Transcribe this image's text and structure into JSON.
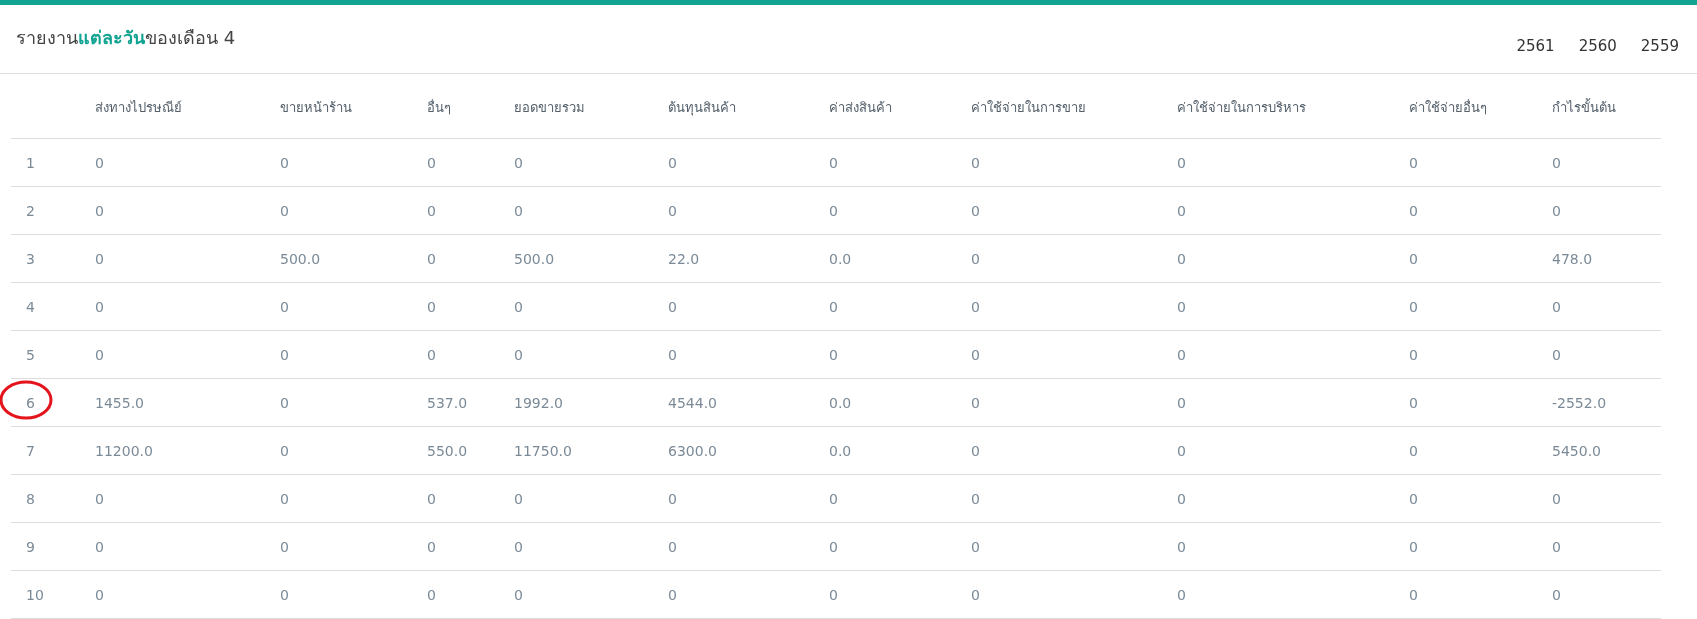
{
  "header": {
    "title": "รายงาน**แต่ละวัน**ของเดือน 4",
    "years": [
      "2561",
      "2560",
      "2559"
    ]
  },
  "table": {
    "columns": [
      "",
      "ส่งทางไปรษณีย์",
      "ขายหน้าร้าน",
      "อื่นๆ",
      "ยอดขายรวม",
      "ต้นทุนสินค้า",
      "ค่าส่งสินค้า",
      "ค่าใช้จ่ายในการขาย",
      "ค่าใช้จ่ายในการบริหาร",
      "ค่าใช้จ่ายอื่นๆ",
      "กำไรขั้นต้น"
    ],
    "rows": [
      {
        "circled": false,
        "cells": [
          "1",
          "0",
          "0",
          "0",
          "0",
          "0",
          "0",
          "0",
          "0",
          "0",
          "0"
        ]
      },
      {
        "circled": false,
        "cells": [
          "2",
          "0",
          "0",
          "0",
          "0",
          "0",
          "0",
          "0",
          "0",
          "0",
          "0"
        ]
      },
      {
        "circled": false,
        "cells": [
          "3",
          "0",
          "500.0",
          "0",
          "500.0",
          "22.0",
          "0.0",
          "0",
          "0",
          "0",
          "478.0"
        ]
      },
      {
        "circled": false,
        "cells": [
          "4",
          "0",
          "0",
          "0",
          "0",
          "0",
          "0",
          "0",
          "0",
          "0",
          "0"
        ]
      },
      {
        "circled": false,
        "cells": [
          "5",
          "0",
          "0",
          "0",
          "0",
          "0",
          "0",
          "0",
          "0",
          "0",
          "0"
        ]
      },
      {
        "circled": true,
        "cells": [
          "6",
          "1455.0",
          "0",
          "537.0",
          "1992.0",
          "4544.0",
          "0.0",
          "0",
          "0",
          "0",
          "-2552.0"
        ]
      },
      {
        "circled": false,
        "cells": [
          "7",
          "11200.0",
          "0",
          "550.0",
          "11750.0",
          "6300.0",
          "0.0",
          "0",
          "0",
          "0",
          "5450.0"
        ]
      },
      {
        "circled": false,
        "cells": [
          "8",
          "0",
          "0",
          "0",
          "0",
          "0",
          "0",
          "0",
          "0",
          "0",
          "0"
        ]
      },
      {
        "circled": false,
        "cells": [
          "9",
          "0",
          "0",
          "0",
          "0",
          "0",
          "0",
          "0",
          "0",
          "0",
          "0"
        ]
      },
      {
        "circled": false,
        "cells": [
          "10",
          "0",
          "0",
          "0",
          "0",
          "0",
          "0",
          "0",
          "0",
          "0",
          "0"
        ]
      }
    ]
  }
}
